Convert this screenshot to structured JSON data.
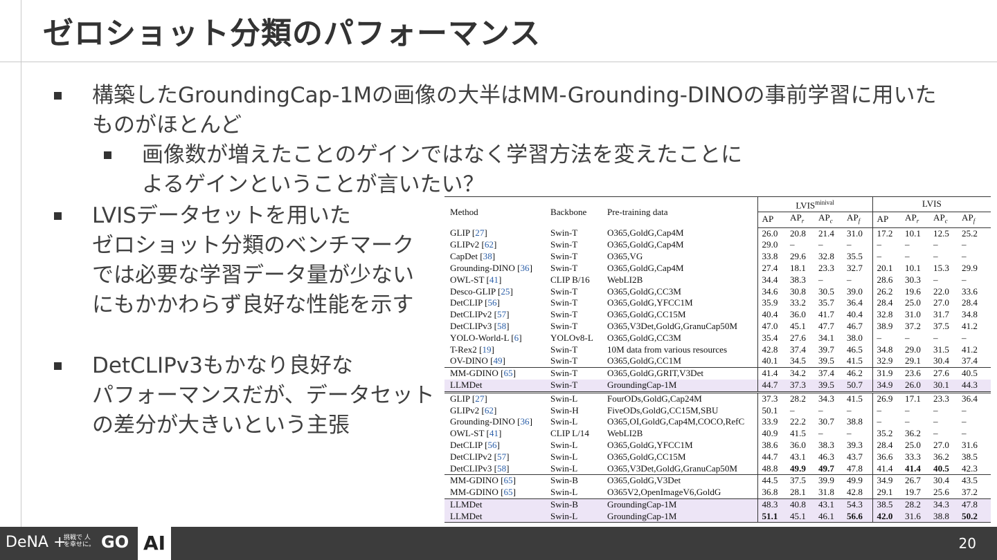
{
  "title": "ゼロショット分類のパフォーマンス",
  "bullets": {
    "b1": [
      "構築したGroundingCap-1Mの画像の大半はMM-Grounding-DINOの事前学習に用いた",
      "ものがほとんど"
    ],
    "b1_sub": [
      "画像数が増えたことのゲインではなく学習方法を変えたことに",
      "よるゲインということが言いたい？"
    ],
    "b2": [
      "LVISデータセットを用いた",
      "ゼロショット分類のベンチマーク",
      "では必要な学習データ量が少ない",
      "にもかかわらず良好な性能を示す"
    ],
    "b3": [
      "DetCLIPv3もかなり良好な",
      "パフォーマンスだが、データセット",
      "の差分が大きいという主張"
    ]
  },
  "table": {
    "headers": {
      "method": "Method",
      "backbone": "Backbone",
      "data": "Pre-training data",
      "group1": "LVIS",
      "group1_sup": "minival",
      "group2": "LVIS",
      "metrics": [
        [
          "AP",
          ""
        ],
        [
          "AP",
          "r"
        ],
        [
          "AP",
          "c"
        ],
        [
          "AP",
          "f"
        ],
        [
          "AP",
          ""
        ],
        [
          "AP",
          "r"
        ],
        [
          "AP",
          "c"
        ],
        [
          "AP",
          "f"
        ]
      ]
    },
    "rows": [
      {
        "m": "GLIP",
        "r": "27",
        "b": "Swin-T",
        "d": "O365,GoldG,Cap4M",
        "v": [
          "26.0",
          "20.8",
          "21.4",
          "31.0",
          "17.2",
          "10.1",
          "12.5",
          "25.2"
        ]
      },
      {
        "m": "GLIPv2",
        "r": "62",
        "b": "Swin-T",
        "d": "O365,GoldG,Cap4M",
        "v": [
          "29.0",
          "–",
          "–",
          "–",
          "–",
          "–",
          "–",
          "–"
        ]
      },
      {
        "m": "CapDet",
        "r": "38",
        "b": "Swin-T",
        "d": "O365,VG",
        "v": [
          "33.8",
          "29.6",
          "32.8",
          "35.5",
          "–",
          "–",
          "–",
          "–"
        ]
      },
      {
        "m": "Grounding-DINO",
        "r": "36",
        "b": "Swin-T",
        "d": "O365,GoldG,Cap4M",
        "v": [
          "27.4",
          "18.1",
          "23.3",
          "32.7",
          "20.1",
          "10.1",
          "15.3",
          "29.9"
        ]
      },
      {
        "m": "OWL-ST",
        "r": "41",
        "b": "CLIP B/16",
        "d": "WebLI2B",
        "v": [
          "34.4",
          "38.3",
          "–",
          "–",
          "28.6",
          "30.3",
          "–",
          "–"
        ]
      },
      {
        "m": "Desco-GLIP",
        "r": "25",
        "b": "Swin-T",
        "d": "O365,GoldG,CC3M",
        "v": [
          "34.6",
          "30.8",
          "30.5",
          "39.0",
          "26.2",
          "19.6",
          "22.0",
          "33.6"
        ]
      },
      {
        "m": "DetCLIP",
        "r": "56",
        "b": "Swin-T",
        "d": "O365,GoldG,YFCC1M",
        "v": [
          "35.9",
          "33.2",
          "35.7",
          "36.4",
          "28.4",
          "25.0",
          "27.0",
          "28.4"
        ]
      },
      {
        "m": "DetCLIPv2",
        "r": "57",
        "b": "Swin-T",
        "d": "O365,GoldG,CC15M",
        "v": [
          "40.4",
          "36.0",
          "41.7",
          "40.4",
          "32.8",
          "31.0",
          "31.7",
          "34.8"
        ]
      },
      {
        "m": "DetCLIPv3",
        "r": "58",
        "b": "Swin-T",
        "d": "O365,V3Det,GoldG,GranuCap50M",
        "v": [
          "47.0",
          "45.1",
          "47.7",
          "46.7",
          "38.9",
          "37.2",
          "37.5",
          "41.2"
        ]
      },
      {
        "m": "YOLO-World-L",
        "r": "6",
        "b": "YOLOv8-L",
        "d": "O365,GoldG,CC3M",
        "v": [
          "35.4",
          "27.6",
          "34.1",
          "38.0",
          "–",
          "–",
          "–",
          "–"
        ]
      },
      {
        "m": "T-Rex2",
        "r": "19",
        "b": "Swin-T",
        "d": "10M data from various resources",
        "v": [
          "42.8",
          "37.4",
          "39.7",
          "46.5",
          "34.8",
          "29.0",
          "31.5",
          "41.2"
        ]
      },
      {
        "m": "OV-DINO",
        "r": "49",
        "b": "Swin-T",
        "d": "O365,GoldG,CC1M",
        "v": [
          "40.1",
          "34.5",
          "39.5",
          "41.5",
          "32.9",
          "29.1",
          "30.4",
          "37.4"
        ]
      },
      {
        "m": "MM-GDINO",
        "r": "65",
        "b": "Swin-T",
        "d": "O365,GoldG,GRIT,V3Det",
        "v": [
          "41.4",
          "34.2",
          "37.4",
          "46.2",
          "31.9",
          "23.6",
          "27.6",
          "40.5"
        ],
        "sep": "single"
      },
      {
        "m": "LLMDet",
        "r": "",
        "b": "Swin-T",
        "d": "GroundingCap-1M",
        "v": [
          "44.7",
          "37.3",
          "39.5",
          "50.7",
          "34.9",
          "26.0",
          "30.1",
          "44.3"
        ],
        "hl": true
      },
      {
        "m": "GLIP",
        "r": "27",
        "b": "Swin-L",
        "d": "FourODs,GoldG,Cap24M",
        "v": [
          "37.3",
          "28.2",
          "34.3",
          "41.5",
          "26.9",
          "17.1",
          "23.3",
          "36.4"
        ],
        "sep": "double"
      },
      {
        "m": "GLIPv2",
        "r": "62",
        "b": "Swin-H",
        "d": "FiveODs,GoldG,CC15M,SBU",
        "v": [
          "50.1",
          "–",
          "–",
          "–",
          "–",
          "–",
          "–",
          "–"
        ]
      },
      {
        "m": "Grounding-DINO",
        "r": "36",
        "b": "Swin-L",
        "d": "O365,OI,GoldG,Cap4M,COCO,RefC",
        "v": [
          "33.9",
          "22.2",
          "30.7",
          "38.8",
          "–",
          "–",
          "–",
          "–"
        ]
      },
      {
        "m": "OWL-ST",
        "r": "41",
        "b": "CLIP L/14",
        "d": "WebLI2B",
        "v": [
          "40.9",
          "41.5",
          "–",
          "–",
          "35.2",
          "36.2",
          "–",
          "–"
        ]
      },
      {
        "m": "DetCLIP",
        "r": "56",
        "b": "Swin-L",
        "d": "O365,GoldG,YFCC1M",
        "v": [
          "38.6",
          "36.0",
          "38.3",
          "39.3",
          "28.4",
          "25.0",
          "27.0",
          "31.6"
        ]
      },
      {
        "m": "DetCLIPv2",
        "r": "57",
        "b": "Swin-L",
        "d": "O365,GoldG,CC15M",
        "v": [
          "44.7",
          "43.1",
          "46.3",
          "43.7",
          "36.6",
          "33.3",
          "36.2",
          "38.5"
        ]
      },
      {
        "m": "DetCLIPv3",
        "r": "58",
        "b": "Swin-L",
        "d": "O365,V3Det,GoldG,GranuCap50M",
        "v": [
          "48.8",
          "49.9",
          "49.7",
          "47.8",
          "41.4",
          "41.4",
          "40.5",
          "42.3"
        ],
        "bold": [
          1,
          2,
          5,
          6
        ]
      },
      {
        "m": "MM-GDINO",
        "r": "65",
        "b": "Swin-B",
        "d": "O365,GoldG,V3Det",
        "v": [
          "44.5",
          "37.5",
          "39.9",
          "49.9",
          "34.9",
          "26.7",
          "30.4",
          "43.5"
        ],
        "sep": "single"
      },
      {
        "m": "MM-GDINO",
        "r": "65",
        "b": "Swin-L",
        "d": "O365V2,OpenImageV6,GoldG",
        "v": [
          "36.8",
          "28.1",
          "31.8",
          "42.8",
          "29.1",
          "19.7",
          "25.6",
          "37.2"
        ]
      },
      {
        "m": "LLMDet",
        "r": "",
        "b": "Swin-B",
        "d": "GroundingCap-1M",
        "v": [
          "48.3",
          "40.8",
          "43.1",
          "54.3",
          "38.5",
          "28.2",
          "34.3",
          "47.8"
        ],
        "hl": true,
        "sep": "single"
      },
      {
        "m": "LLMDet",
        "r": "",
        "b": "Swin-L",
        "d": "GroundingCap-1M",
        "v": [
          "51.1",
          "45.1",
          "46.1",
          "56.6",
          "42.0",
          "31.6",
          "38.8",
          "50.2"
        ],
        "hl": true,
        "bold": [
          0,
          3,
          4,
          7
        ]
      }
    ]
  },
  "footer": {
    "logo": "DeNA",
    "plus": "+",
    "tagline": "挑戦で 人を幸せに。",
    "go_logo": "GO",
    "ai_label": "AI",
    "page_number": "20"
  }
}
